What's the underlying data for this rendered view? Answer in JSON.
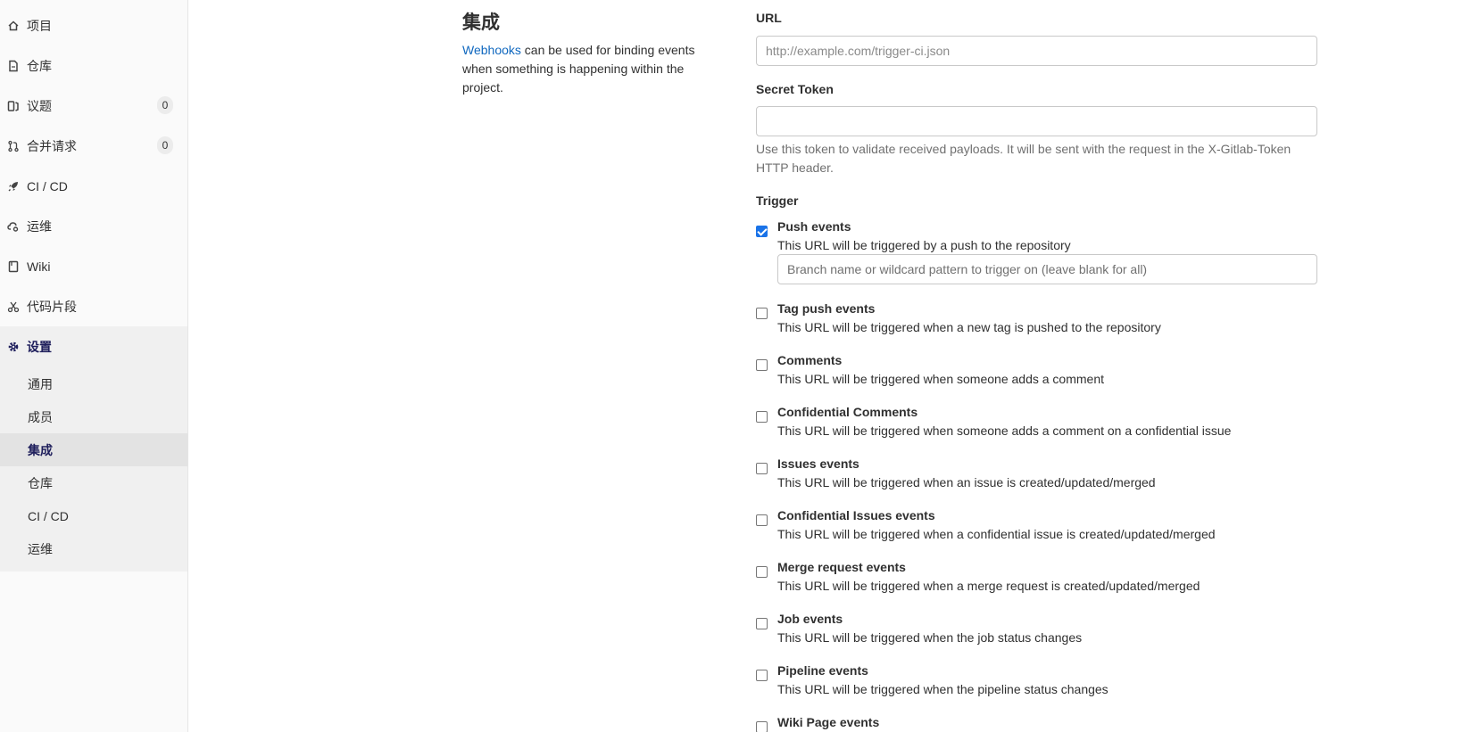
{
  "sidebar": {
    "items": [
      {
        "label": "项目",
        "icon": "home-icon"
      },
      {
        "label": "仓库",
        "icon": "document-icon"
      },
      {
        "label": "议题",
        "icon": "issues-icon",
        "badge": "0"
      },
      {
        "label": "合并请求",
        "icon": "merge-request-icon",
        "badge": "0"
      },
      {
        "label": "CI / CD",
        "icon": "rocket-icon"
      },
      {
        "label": "运维",
        "icon": "cloud-gear-icon"
      },
      {
        "label": "Wiki",
        "icon": "book-icon"
      },
      {
        "label": "代码片段",
        "icon": "scissors-icon"
      },
      {
        "label": "设置",
        "icon": "gear-icon"
      }
    ],
    "settings_sub": [
      "通用",
      "成员",
      "集成",
      "仓库",
      "CI / CD",
      "运维"
    ],
    "active_sub": "集成"
  },
  "main": {
    "title": "集成",
    "intro_link": "Webhooks",
    "intro_text": " can be used for binding events when something is happening within the project."
  },
  "form": {
    "url_label": "URL",
    "url_placeholder": "http://example.com/trigger-ci.json",
    "url_value": "",
    "token_label": "Secret Token",
    "token_value": "",
    "token_help": "Use this token to validate received payloads. It will be sent with the request in the X-Gitlab-Token HTTP header.",
    "trigger_label": "Trigger",
    "branch_placeholder": "Branch name or wildcard pattern to trigger on (leave blank for all)",
    "triggers": [
      {
        "title": "Push events",
        "desc": "This URL will be triggered by a push to the repository",
        "checked": true
      },
      {
        "title": "Tag push events",
        "desc": "This URL will be triggered when a new tag is pushed to the repository",
        "checked": false
      },
      {
        "title": "Comments",
        "desc": "This URL will be triggered when someone adds a comment",
        "checked": false
      },
      {
        "title": "Confidential Comments",
        "desc": "This URL will be triggered when someone adds a comment on a confidential issue",
        "checked": false
      },
      {
        "title": "Issues events",
        "desc": "This URL will be triggered when an issue is created/updated/merged",
        "checked": false
      },
      {
        "title": "Confidential Issues events",
        "desc": "This URL will be triggered when a confidential issue is created/updated/merged",
        "checked": false
      },
      {
        "title": "Merge request events",
        "desc": "This URL will be triggered when a merge request is created/updated/merged",
        "checked": false
      },
      {
        "title": "Job events",
        "desc": "This URL will be triggered when the job status changes",
        "checked": false
      },
      {
        "title": "Pipeline events",
        "desc": "This URL will be triggered when the pipeline status changes",
        "checked": false
      },
      {
        "title": "Wiki Page events",
        "desc": "",
        "checked": false
      }
    ]
  },
  "colors": {
    "link": "#1068bf",
    "checkbox_checked": "#1a73e8",
    "active_nav_text": "#1f1f5c"
  }
}
